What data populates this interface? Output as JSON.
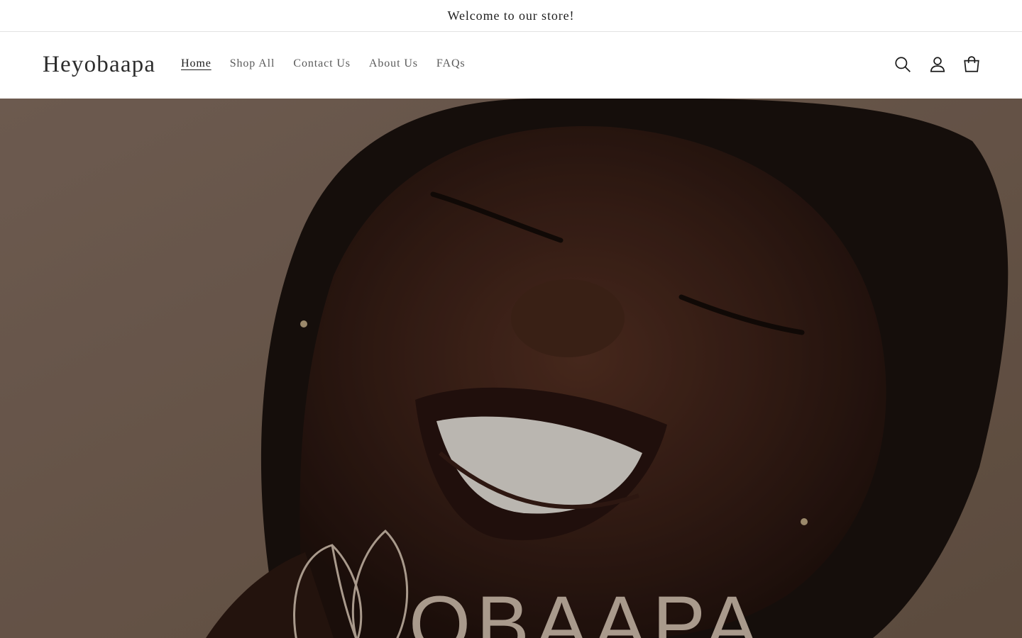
{
  "announcement": {
    "text": "Welcome to our store!"
  },
  "header": {
    "logo": "Heyobaapa",
    "nav": [
      {
        "label": "Home",
        "active": true
      },
      {
        "label": "Shop All",
        "active": false
      },
      {
        "label": "Contact Us",
        "active": false
      },
      {
        "label": "About Us",
        "active": false
      },
      {
        "label": "FAQs",
        "active": false
      }
    ],
    "icons": [
      "search-icon",
      "account-icon",
      "cart-icon"
    ]
  },
  "hero": {
    "image": "smiling-woman-portrait",
    "brand_mark": "OBAAPA",
    "background_color": "#806a5d",
    "brand_mark_color": "#a99a8c"
  }
}
